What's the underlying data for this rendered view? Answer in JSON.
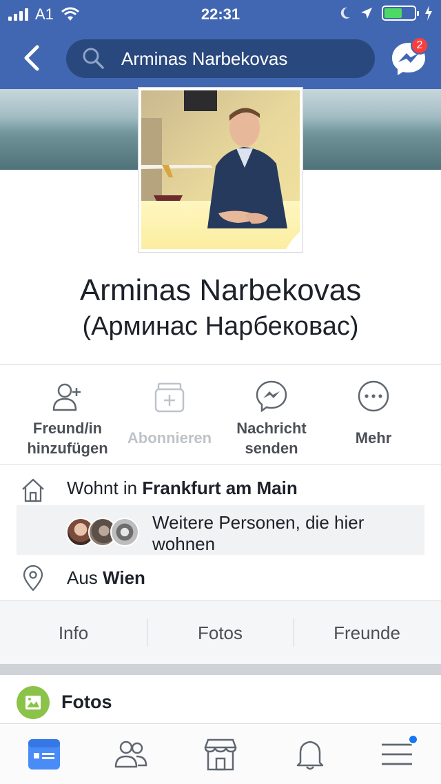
{
  "status_bar": {
    "carrier": "A1",
    "time": "22:31"
  },
  "header": {
    "search_value": "Arminas Narbekovas",
    "messenger_badge": "2"
  },
  "profile": {
    "name": "Arminas Narbekovas",
    "alt_name": "(Арминас Нарбековас)"
  },
  "actions": [
    {
      "label_line1": "Freund/in",
      "label_line2": "hinzufügen",
      "icon": "add-friend-icon"
    },
    {
      "label_line1": "Abonnieren",
      "icon": "follow-icon"
    },
    {
      "label_line1": "Nachricht",
      "label_line2": "senden",
      "icon": "messenger-icon"
    },
    {
      "label_line1": "Mehr",
      "icon": "more-icon"
    }
  ],
  "info": {
    "lives_prefix": "Wohnt in ",
    "lives_city": "Frankfurt am Main",
    "people_text": "Weitere Personen, die hier wohnen",
    "from_prefix": "Aus ",
    "from_city": "Wien"
  },
  "tabs": [
    "Info",
    "Fotos",
    "Freunde"
  ],
  "fotos_section": {
    "title": "Fotos"
  },
  "colors": {
    "brand_blue": "#4267b2",
    "search_bg": "#29487d",
    "badge_red": "#fa3e3e",
    "photos_green": "#8bc34a",
    "active_tab_blue": "#4a8cf7"
  }
}
